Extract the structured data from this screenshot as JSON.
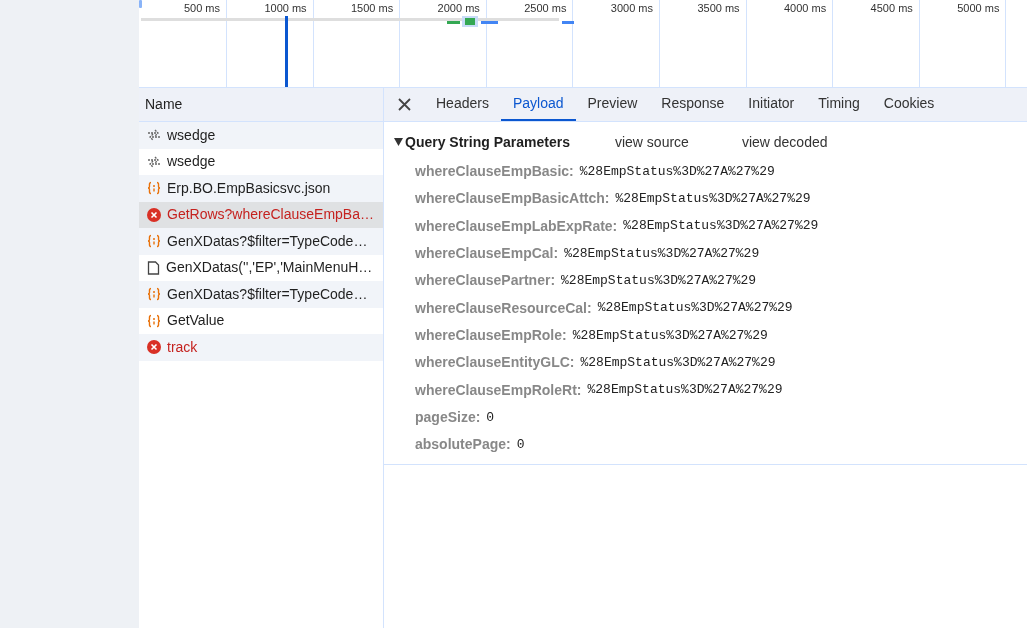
{
  "timeline": {
    "ticks": [
      "500 ms",
      "1000 ms",
      "1500 ms",
      "2000 ms",
      "2500 ms",
      "3000 ms",
      "3500 ms",
      "4000 ms",
      "4500 ms",
      "5000 ms"
    ]
  },
  "requests": {
    "column": "Name",
    "rows": [
      {
        "name": "wsedge",
        "kind": "websocket",
        "selected": false,
        "error": false
      },
      {
        "name": "wsedge",
        "kind": "websocket",
        "selected": false,
        "error": false
      },
      {
        "name": "Erp.BO.EmpBasicsvc.json",
        "kind": "fetch",
        "selected": false,
        "error": false
      },
      {
        "name": "GetRows?whereClauseEmpBa…",
        "kind": "failed",
        "selected": true,
        "error": true
      },
      {
        "name": "GenXDatas?$filter=TypeCode…",
        "kind": "fetch",
        "selected": false,
        "error": false
      },
      {
        "name": "GenXDatas('','EP','MainMenuH…",
        "kind": "document",
        "selected": false,
        "error": false
      },
      {
        "name": "GenXDatas?$filter=TypeCode…",
        "kind": "fetch",
        "selected": false,
        "error": false
      },
      {
        "name": "GetValue",
        "kind": "fetch",
        "selected": false,
        "error": false
      },
      {
        "name": "track",
        "kind": "failed",
        "selected": false,
        "error": true
      }
    ]
  },
  "tabs": [
    {
      "label": "Headers",
      "selected": false
    },
    {
      "label": "Payload",
      "selected": true
    },
    {
      "label": "Preview",
      "selected": false
    },
    {
      "label": "Response",
      "selected": false
    },
    {
      "label": "Initiator",
      "selected": false
    },
    {
      "label": "Timing",
      "selected": false
    },
    {
      "label": "Cookies",
      "selected": false
    }
  ],
  "payload": {
    "title": "Query String Parameters",
    "expanded": true,
    "links": [
      "view source",
      "view decoded"
    ],
    "params": [
      {
        "key": "whereClauseEmpBasic:",
        "value": "%28EmpStatus%3D%27A%27%29"
      },
      {
        "key": "whereClauseEmpBasicAttch:",
        "value": "%28EmpStatus%3D%27A%27%29"
      },
      {
        "key": "whereClauseEmpLabExpRate:",
        "value": "%28EmpStatus%3D%27A%27%29"
      },
      {
        "key": "whereClauseEmpCal:",
        "value": "%28EmpStatus%3D%27A%27%29"
      },
      {
        "key": "whereClausePartner:",
        "value": "%28EmpStatus%3D%27A%27%29"
      },
      {
        "key": "whereClauseResourceCal:",
        "value": "%28EmpStatus%3D%27A%27%29"
      },
      {
        "key": "whereClauseEmpRole:",
        "value": "%28EmpStatus%3D%27A%27%29"
      },
      {
        "key": "whereClauseEntityGLC:",
        "value": "%28EmpStatus%3D%27A%27%29"
      },
      {
        "key": "whereClauseEmpRoleRt:",
        "value": "%28EmpStatus%3D%27A%27%29"
      },
      {
        "key": "pageSize:",
        "value": "0"
      },
      {
        "key": "absolutePage:",
        "value": "0"
      }
    ]
  }
}
